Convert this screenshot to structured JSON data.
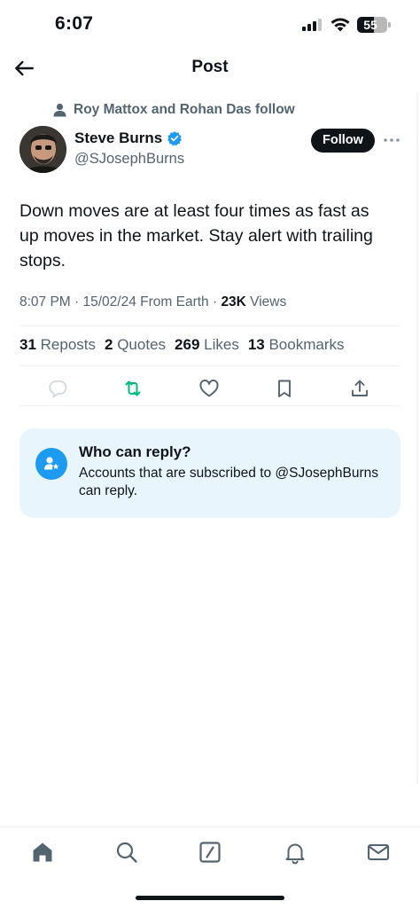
{
  "status_bar": {
    "time": "6:07",
    "battery": "55",
    "battery_level": 0.55,
    "icons": [
      "signal-icon",
      "wifi-icon",
      "battery-icon"
    ]
  },
  "header": {
    "title": "Post",
    "back_icon": "arrow-left-icon"
  },
  "social_context": {
    "text": "Roy Mattox and Rohan Das follow",
    "icon": "person-icon"
  },
  "author": {
    "name": "Steve Burns",
    "handle": "@SJosephBurns",
    "verified": true,
    "follow_label": "Follow",
    "more_icon": "more-horizontal-icon"
  },
  "post": {
    "text": "Down moves are at least four times as fast as up moves in the market. Stay alert with trailing stops.",
    "time": "8:07 PM · 15/02/24 From Earth · ",
    "views_count": "23K",
    "views_label": " Views"
  },
  "stats": [
    {
      "count": "31",
      "label": " Reposts"
    },
    {
      "count": "2",
      "label": " Quotes"
    },
    {
      "count": "269",
      "label": " Likes"
    },
    {
      "count": "13",
      "label": " Bookmarks"
    }
  ],
  "actions": [
    "reply-icon",
    "repost-icon",
    "like-icon",
    "bookmark-icon",
    "share-icon"
  ],
  "reply_restriction": {
    "title": "Who can reply?",
    "body": "Accounts that are subscribed to @SJosephBurns can reply.",
    "icon": "person-star-icon"
  },
  "tabs": [
    "home-icon",
    "search-icon",
    "compose-icon",
    "notifications-icon",
    "messages-icon"
  ],
  "colors": {
    "accent": "#1d9bf0",
    "repost_green": "#00ba7c",
    "text": "#0f1419",
    "secondary": "#536471",
    "card_bg": "#e8f5fd"
  }
}
